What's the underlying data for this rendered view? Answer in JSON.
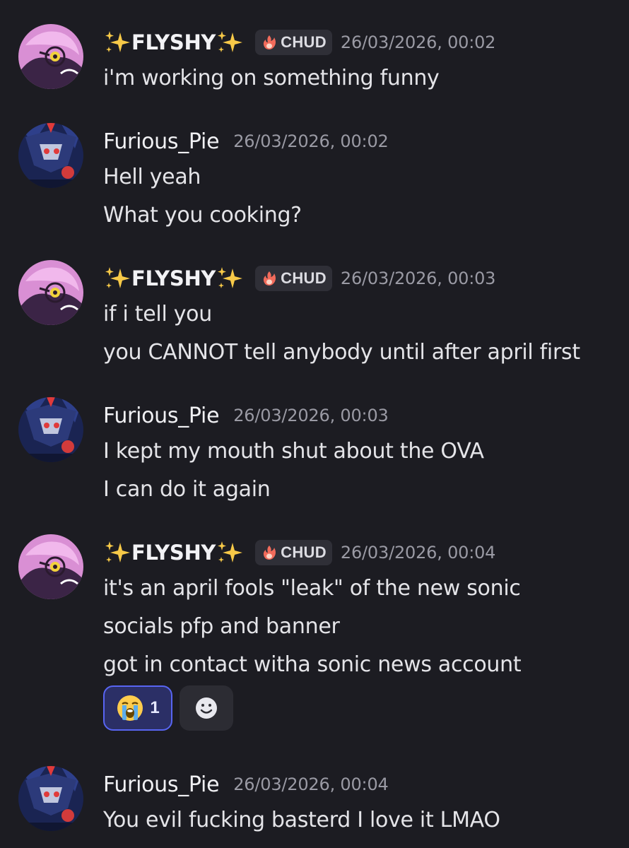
{
  "messages": [
    {
      "author": "FLYSHY",
      "role": "CHUD",
      "timestamp": "26/03/2026, 00:02",
      "lines": [
        "i'm working on something funny"
      ]
    },
    {
      "author": "Furious_Pie",
      "timestamp": "26/03/2026, 00:02",
      "lines": [
        "Hell yeah",
        "What you cooking?"
      ]
    },
    {
      "author": "FLYSHY",
      "role": "CHUD",
      "timestamp": "26/03/2026, 00:03",
      "lines": [
        "if i tell you",
        "you CANNOT tell anybody until after april first"
      ]
    },
    {
      "author": "Furious_Pie",
      "timestamp": "26/03/2026, 00:03",
      "lines": [
        "I kept my mouth shut about the OVA",
        "I can do it again"
      ]
    },
    {
      "author": "FLYSHY",
      "role": "CHUD",
      "timestamp": "26/03/2026, 00:04",
      "lines": [
        "it's an april fools \"leak\" of the new sonic",
        "socials pfp and banner",
        "got in contact witha sonic news account"
      ],
      "reactions": [
        {
          "emoji": "😭",
          "count": "1",
          "icon": "loudly-crying-face-icon",
          "active": true
        },
        {
          "icon": "add-reaction-icon"
        }
      ]
    },
    {
      "author": "Furious_Pie",
      "timestamp": "26/03/2026, 00:04",
      "lines": [
        "You evil fucking basterd I love it LMAO"
      ]
    }
  ],
  "theme": {
    "background": "#1c1c22",
    "role_tag_bg": "#2f2f37",
    "reaction_active_bg": "#2b2f66",
    "reaction_active_border": "#5865f2",
    "timestamp_color": "#9a9aa4"
  }
}
